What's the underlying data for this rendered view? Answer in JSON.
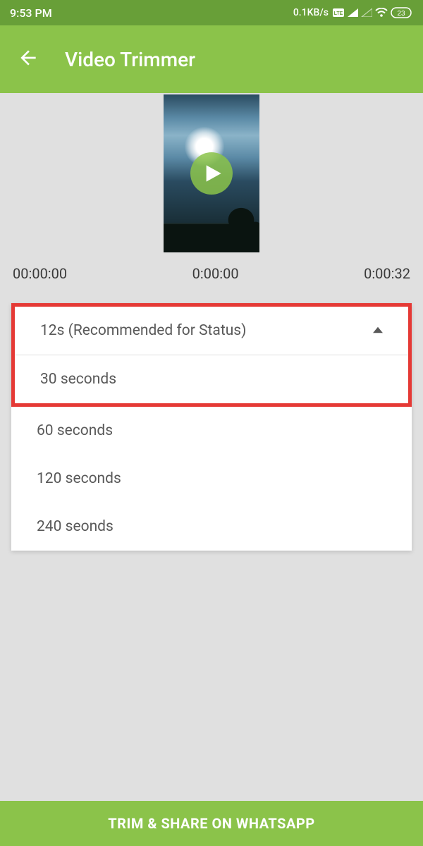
{
  "status": {
    "time": "9:53 PM",
    "net_speed": "0.1KB/s",
    "battery": "23"
  },
  "header": {
    "title": "Video Trimmer"
  },
  "times": {
    "start": "00:00:00",
    "current": "0:00:00",
    "end": "0:00:32"
  },
  "dropdown": {
    "selected": "12s (Recommended for Status)",
    "options": [
      "30 seconds",
      "60 seconds",
      "120 seconds",
      "240 seonds"
    ]
  },
  "action": {
    "label": "TRIM & SHARE ON WHATSAPP"
  }
}
